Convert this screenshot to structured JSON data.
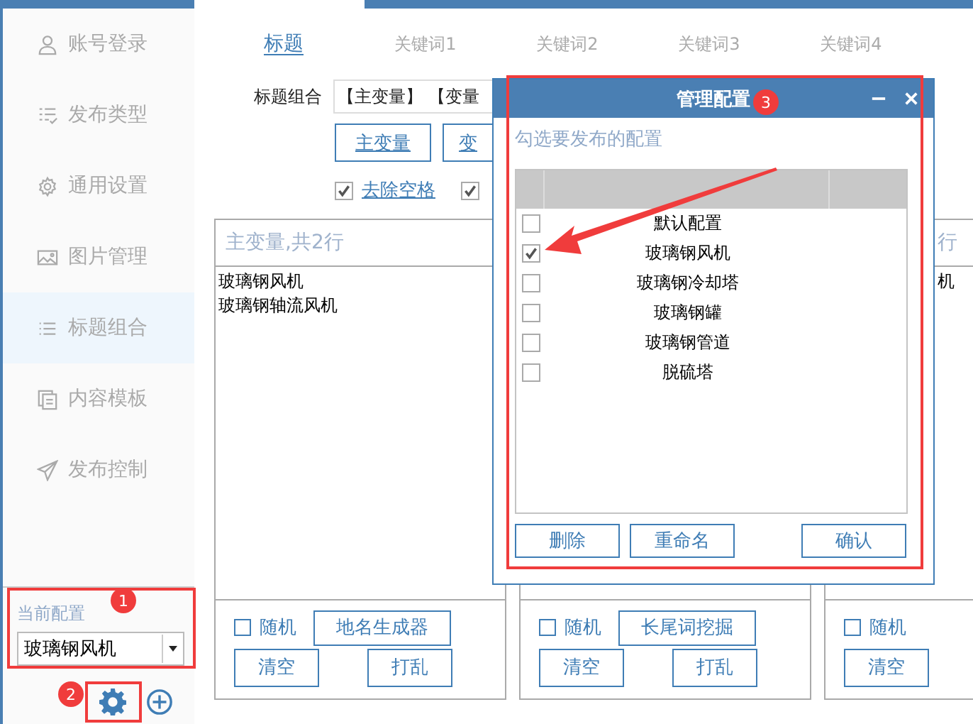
{
  "sidebar": {
    "items": [
      {
        "label": "账号登录",
        "selected": false
      },
      {
        "label": "发布类型",
        "selected": false
      },
      {
        "label": "通用设置",
        "selected": false
      },
      {
        "label": "图片管理",
        "selected": false
      },
      {
        "label": "标题组合",
        "selected": true
      },
      {
        "label": "内容模板",
        "selected": false
      },
      {
        "label": "发布控制",
        "selected": false
      }
    ],
    "current_config": {
      "label": "当前配置",
      "value": "玻璃钢风机"
    }
  },
  "tabs": [
    {
      "label": "标题",
      "selected": true
    },
    {
      "label": "关键词1",
      "selected": false
    },
    {
      "label": "关键词2",
      "selected": false
    },
    {
      "label": "关键词3",
      "selected": false
    },
    {
      "label": "关键词4",
      "selected": false
    }
  ],
  "title_combo": {
    "label": "标题组合",
    "value": "【主变量】 【变量"
  },
  "variable_buttons": [
    "主变量",
    "变"
  ],
  "options": [
    {
      "label": "去除空格",
      "checked": true
    },
    {
      "checked": true
    }
  ],
  "panels": [
    {
      "kind": "full",
      "header": "主变量,共2行",
      "lines": [
        "玻璃钢风机",
        "玻璃钢轴流风机"
      ],
      "random": {
        "label": "随机",
        "checked": false
      },
      "tool_button": "地名生成器",
      "buttons": [
        "清空",
        "打乱"
      ]
    },
    {
      "kind": "hidden",
      "random": {
        "label": "随机",
        "checked": false
      },
      "tool_button": "长尾词挖掘",
      "buttons": [
        "清空",
        "打乱"
      ]
    },
    {
      "kind": "clipped",
      "header": "行",
      "lines": [
        "机"
      ],
      "random": {
        "label": "随机",
        "checked": false
      },
      "buttons": [
        "清空"
      ]
    }
  ],
  "dialog": {
    "title": "管理配置",
    "hint": "勾选要发布的配置",
    "rows": [
      {
        "name": "默认配置",
        "checked": false
      },
      {
        "name": "玻璃钢风机",
        "checked": true
      },
      {
        "name": "玻璃钢冷却塔",
        "checked": false
      },
      {
        "name": "玻璃钢罐",
        "checked": false
      },
      {
        "name": "玻璃钢管道",
        "checked": false
      },
      {
        "name": "脱硫塔",
        "checked": false
      }
    ],
    "buttons": [
      "删除",
      "重命名",
      "确认"
    ]
  },
  "annotations": [
    "1",
    "2",
    "3"
  ]
}
